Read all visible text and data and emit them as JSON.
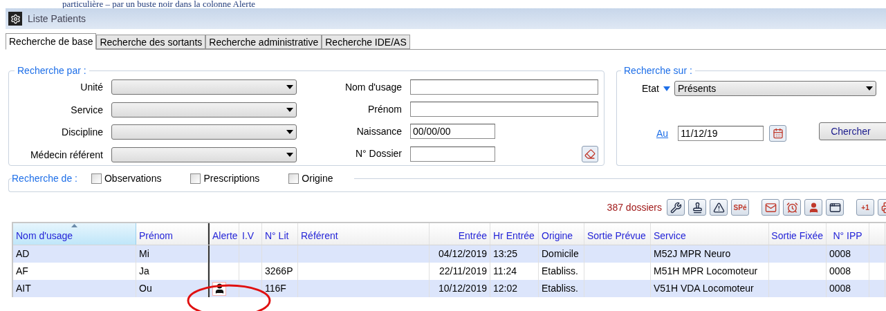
{
  "document_text": "particulière – par un buste noir dans la colonne Alerte",
  "window": {
    "title": "Liste Patients"
  },
  "tabs": [
    {
      "label": "Recherche de base",
      "selected": true
    },
    {
      "label": "Recherche des sortants",
      "selected": false
    },
    {
      "label": "Recherche administrative",
      "selected": false
    },
    {
      "label": "Recherche IDE/AS",
      "selected": false
    }
  ],
  "search_by": {
    "title": "Recherche par  :",
    "dropdowns": [
      {
        "label": "Unité"
      },
      {
        "label": "Service"
      },
      {
        "label": "Discipline"
      },
      {
        "label": "Médecin référent"
      }
    ],
    "fields": [
      {
        "label": "Nom d'usage"
      },
      {
        "label": "Prénom"
      },
      {
        "label": "Naissance",
        "value": "00/00/00"
      },
      {
        "label": "N° Dossier"
      }
    ]
  },
  "search_on": {
    "title": "Recherche sur :",
    "state_label": "Etat",
    "state_value": "Présents",
    "date_link": "Au",
    "date_value": "11/12/19",
    "search_button": "Chercher"
  },
  "search_in": {
    "title": "Recherche de :",
    "options": [
      {
        "label": "Observations",
        "checked": false
      },
      {
        "label": "Prescriptions",
        "checked": false
      },
      {
        "label": "Origine",
        "checked": false
      }
    ]
  },
  "toolbar": {
    "count": "387 dossiers",
    "buttons": [
      {
        "kind": "wrench"
      },
      {
        "kind": "stamp"
      },
      {
        "kind": "warning"
      },
      {
        "kind": "text",
        "label": "SPé"
      },
      {
        "kind": "mail"
      },
      {
        "kind": "alarm"
      },
      {
        "kind": "person"
      },
      {
        "kind": "window"
      },
      {
        "kind": "text",
        "label": "+1"
      },
      {
        "kind": "printer"
      }
    ]
  },
  "table": {
    "columns": [
      {
        "label": "Nom d'usage",
        "sorted": true
      },
      {
        "label": "Prénom",
        "sorted": false
      },
      {
        "label": "Alerte",
        "sorted": false
      },
      {
        "label": "I.V",
        "sorted": false
      },
      {
        "label": "N° Lit",
        "sorted": false
      },
      {
        "label": "Référent",
        "sorted": false
      },
      {
        "label": "Entrée",
        "sorted": false
      },
      {
        "label": "Hr Entrée",
        "sorted": false
      },
      {
        "label": "Origine",
        "sorted": false
      },
      {
        "label": "Sortie Prévue",
        "sorted": false
      },
      {
        "label": "Service",
        "sorted": false
      },
      {
        "label": "Sortie Fixée",
        "sorted": false
      },
      {
        "label": "N° IPP",
        "sorted": false
      }
    ],
    "rows": [
      {
        "alert": false,
        "cells": [
          "AD",
          "Mi",
          null,
          null,
          null,
          null,
          "04/12/2019",
          "13:25",
          "Domicile",
          null,
          "M52J MPR Neuro",
          null,
          "0008"
        ]
      },
      {
        "alert": false,
        "cells": [
          "AF",
          "Ja",
          null,
          null,
          "3266P",
          null,
          "22/11/2019",
          "11:24",
          "Etabliss.",
          null,
          "M51H MPR Locomoteur",
          null,
          "0008"
        ]
      },
      {
        "alert": true,
        "cells": [
          "AIT",
          "Ou",
          null,
          null,
          "116F",
          null,
          "10/12/2019",
          "12:02",
          "Etabliss.",
          null,
          "V51H VDA Locomoteur",
          null,
          "0008"
        ]
      }
    ]
  }
}
